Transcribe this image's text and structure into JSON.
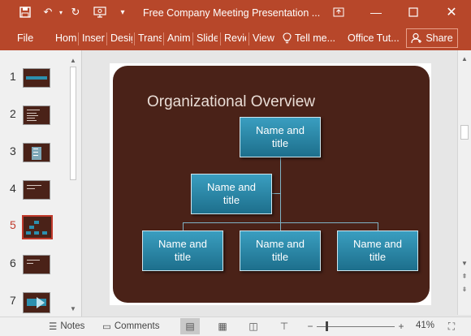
{
  "window": {
    "title": "Free Company Meeting Presentation ...",
    "quick_access": [
      "save-icon",
      "undo-icon",
      "redo-icon",
      "present-icon",
      "customize-icon"
    ],
    "controls": [
      "ribbon-display-icon",
      "minimize-icon",
      "maximize-icon",
      "close-icon"
    ]
  },
  "ribbon": {
    "tabs": [
      "File",
      "Home",
      "Insert",
      "Design",
      "Transitions",
      "Animations",
      "Slide Show",
      "Review",
      "View"
    ],
    "tell_me": "Tell me...",
    "office_tutorials": "Office Tut...",
    "share": "Share"
  },
  "thumbnails": {
    "numbers": [
      "1",
      "2",
      "3",
      "4",
      "5",
      "6",
      "7"
    ],
    "selected": "5"
  },
  "slide": {
    "title": "Organizational Overview",
    "nodes": [
      {
        "line1": "Name and",
        "line2": "title"
      },
      {
        "line1": "Name and",
        "line2": "title"
      },
      {
        "line1": "Name and",
        "line2": "title"
      },
      {
        "line1": "Name and",
        "line2": "title"
      },
      {
        "line1": "Name and",
        "line2": "title"
      }
    ]
  },
  "statusbar": {
    "notes": "Notes",
    "comments": "Comments",
    "zoom": "41%"
  },
  "colors": {
    "accent": "#b7472a",
    "slide_bg": "#4a2218",
    "node": "#2c8fae",
    "selected_thumb": "#c0392b"
  }
}
